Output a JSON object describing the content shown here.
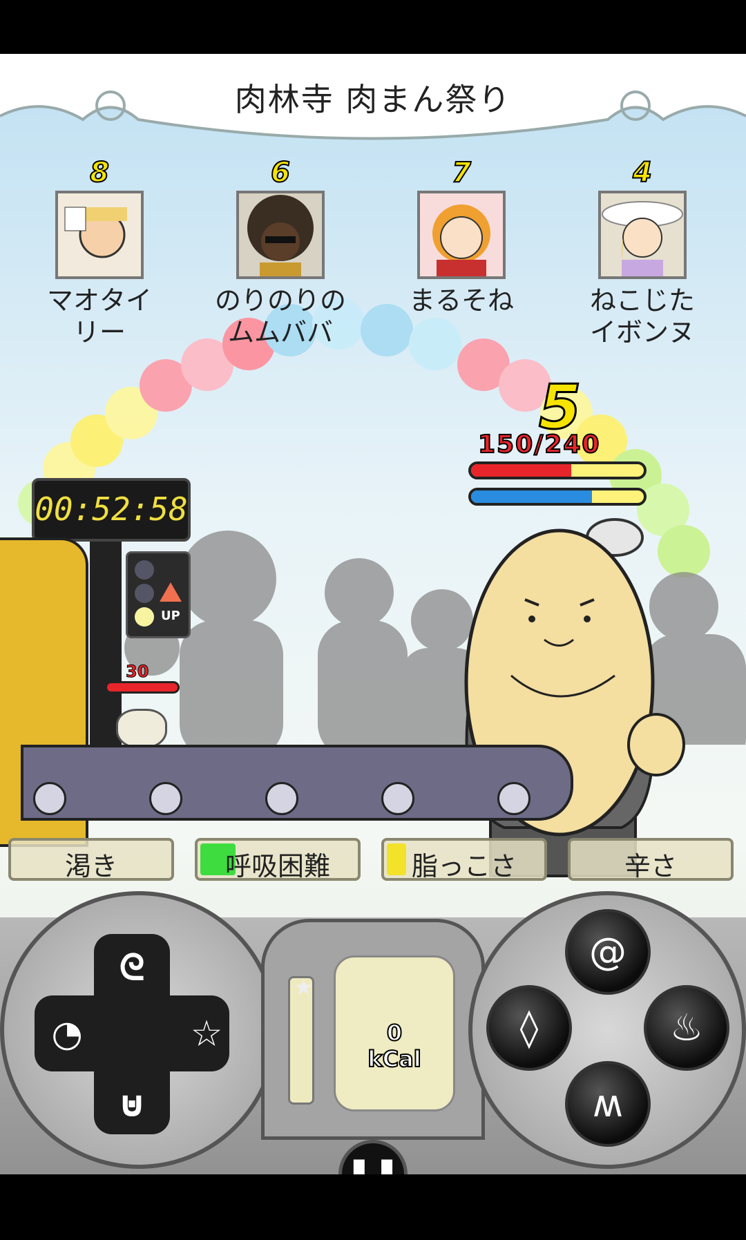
{
  "title": "肉林寺 肉まん祭り",
  "rivals": [
    {
      "rank": "8",
      "name": "マオタイ\nリー"
    },
    {
      "rank": "6",
      "name": "のりのりの\nムムババ"
    },
    {
      "rank": "7",
      "name": "まるそね"
    },
    {
      "rank": "4",
      "name": "ねこじた\nイボンヌ"
    }
  ],
  "player": {
    "count": "5",
    "hp_text": "150/240",
    "hp_fraction": 0.58,
    "stamina_fraction": 0.7
  },
  "timer": "00:52:58",
  "signal": {
    "up_label": "UP"
  },
  "bun": {
    "value": "30"
  },
  "status_meters": [
    {
      "label": "渇き",
      "level": 0.0,
      "color": "#7ad040"
    },
    {
      "label": "呼吸困難",
      "level": 0.22,
      "color": "#3fdc3f"
    },
    {
      "label": "脂っこさ",
      "level": 0.12,
      "color": "#f2e22a"
    },
    {
      "label": "辛さ",
      "level": 0.0,
      "color": "#f2e22a"
    }
  ],
  "kcal": {
    "value": "0",
    "unit": "kCal"
  },
  "icons": {
    "dpad_up": "swirl-icon",
    "dpad_left": "chomp-icon",
    "dpad_right": "star-icon",
    "dpad_down": "cup-icon",
    "action_top": "spiral-icon",
    "action_left": "drop-icon",
    "action_right": "flame-icon",
    "action_bottom": "zigzag-icon",
    "pause": "pause-icon"
  }
}
